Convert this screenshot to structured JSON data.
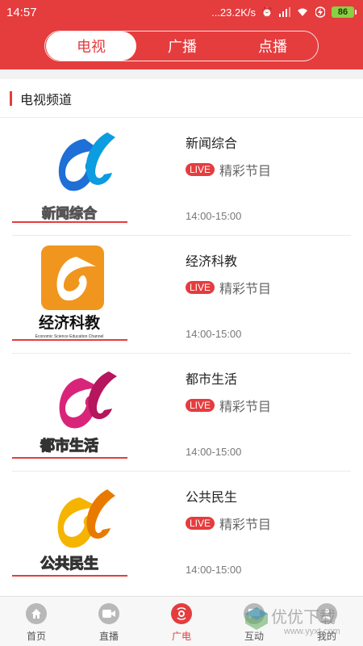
{
  "status_bar": {
    "time": "14:57",
    "network_speed": "...23.2K/s",
    "battery": "86",
    "icons": [
      "alarm-icon",
      "signal-icon",
      "wifi-icon",
      "charging-icon"
    ]
  },
  "top_tabs": [
    {
      "label": "电视",
      "active": true
    },
    {
      "label": "广播",
      "active": false
    },
    {
      "label": "点播",
      "active": false
    }
  ],
  "section": {
    "title": "电视频道"
  },
  "channels": [
    {
      "name": "新闻综合",
      "live_label": "LIVE",
      "program": "精彩节目",
      "time": "14:00-15:00",
      "logo_text": "新闻综合",
      "logo_color": "#1e6fd6"
    },
    {
      "name": "经济科教",
      "live_label": "LIVE",
      "program": "精彩节目",
      "time": "14:00-15:00",
      "logo_text": "经济科教",
      "logo_sub": "Economic Science Education Channel",
      "logo_color": "#f0961e"
    },
    {
      "name": "都市生活",
      "live_label": "LIVE",
      "program": "精彩节目",
      "time": "14:00-15:00",
      "logo_text": "都市生活",
      "logo_color": "#d8257a"
    },
    {
      "name": "公共民生",
      "live_label": "LIVE",
      "program": "精彩节目",
      "time": "14:00-15:00",
      "logo_text": "公共民生",
      "logo_color": "#f5b400"
    }
  ],
  "bottom_nav": [
    {
      "label": "首页",
      "icon": "home-icon",
      "active": false
    },
    {
      "label": "直播",
      "icon": "camera-icon",
      "active": false
    },
    {
      "label": "广电",
      "icon": "radio-icon",
      "active": true
    },
    {
      "label": "互动",
      "icon": "chat-icon",
      "active": false
    },
    {
      "label": "我的",
      "icon": "user-icon",
      "active": false
    }
  ],
  "watermark": {
    "text": "优优下载",
    "sub": "www.yyxt.com"
  },
  "colors": {
    "accent": "#e53c3e",
    "background": "#ffffff"
  }
}
